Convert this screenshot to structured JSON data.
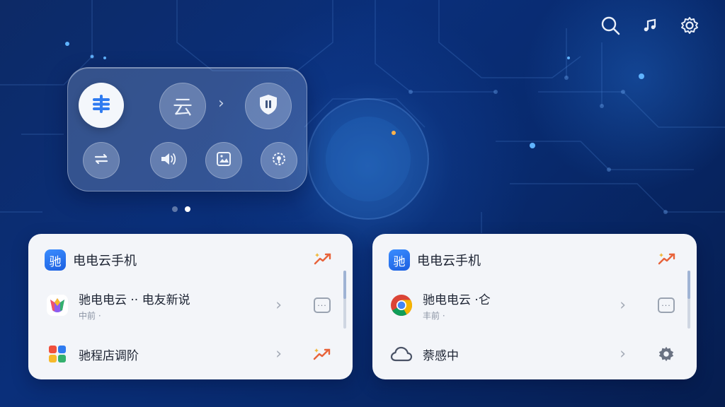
{
  "top_icons": [
    "search-icon",
    "music-note-icon",
    "settings-icon"
  ],
  "panel": {
    "primary_icon": "equal-lines-icon",
    "cloud_label": "云",
    "shield_icon": "shield-pause-icon",
    "bottom_icons": [
      "swap-icon",
      "speaker-icon",
      "image-frame-icon",
      "record-icon"
    ],
    "page_indicator": {
      "count": 2,
      "active": 2
    }
  },
  "cards": [
    {
      "badge": "驰",
      "title": "电电云手机",
      "rows": [
        {
          "title": "驰电电云 ·· 电友新说",
          "subtitle": "中前 ·",
          "icon": "colorful-app-icon",
          "action": "message-icon"
        },
        {
          "title": "驰程店调阶",
          "subtitle": "",
          "icon": "grid-app-icon",
          "action": "trend-icon"
        }
      ]
    },
    {
      "badge": "驰",
      "title": "电电云手机",
      "rows": [
        {
          "title": "驰电电云 ·仑",
          "subtitle": "丰前 ·",
          "icon": "chrome-icon",
          "action": "message-icon"
        },
        {
          "title": "萘感中",
          "subtitle": "",
          "icon": "cloud-outline-icon",
          "action": "gear-icon"
        }
      ]
    }
  ],
  "colors": {
    "accent": "#2f7bf0",
    "trend": "#e8633a",
    "card_bg": "#f3f5f9"
  }
}
